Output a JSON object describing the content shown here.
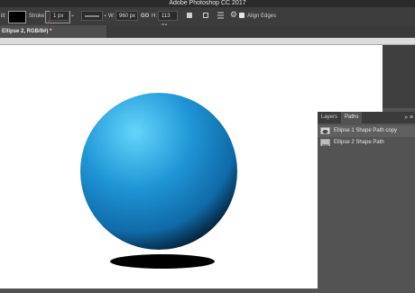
{
  "app": {
    "title": "Adobe Photoshop CC 2017"
  },
  "options": {
    "tool_label": "ill:",
    "stroke_label": "Stroke:",
    "stroke_width": "1 px",
    "w_label": "W:",
    "w_value": "960 px",
    "link_glyph": "GO",
    "h_label": "H:",
    "h_value": "113 px",
    "align_edges_label": "Align Edges"
  },
  "document": {
    "tab_title": "Ellipse 2, RGB/8#) *"
  },
  "panel": {
    "tabs": [
      "Layers",
      "Paths"
    ],
    "active_tab": "Paths",
    "paths": [
      "Ellipse 1 Shape Path copy",
      "Ellipse 2 Shape Path"
    ]
  },
  "colors": {
    "sphere_light": "#54cdf9",
    "sphere_mid": "#1b8fd1",
    "sphere_dark": "#052238",
    "shadow": "#000000"
  }
}
